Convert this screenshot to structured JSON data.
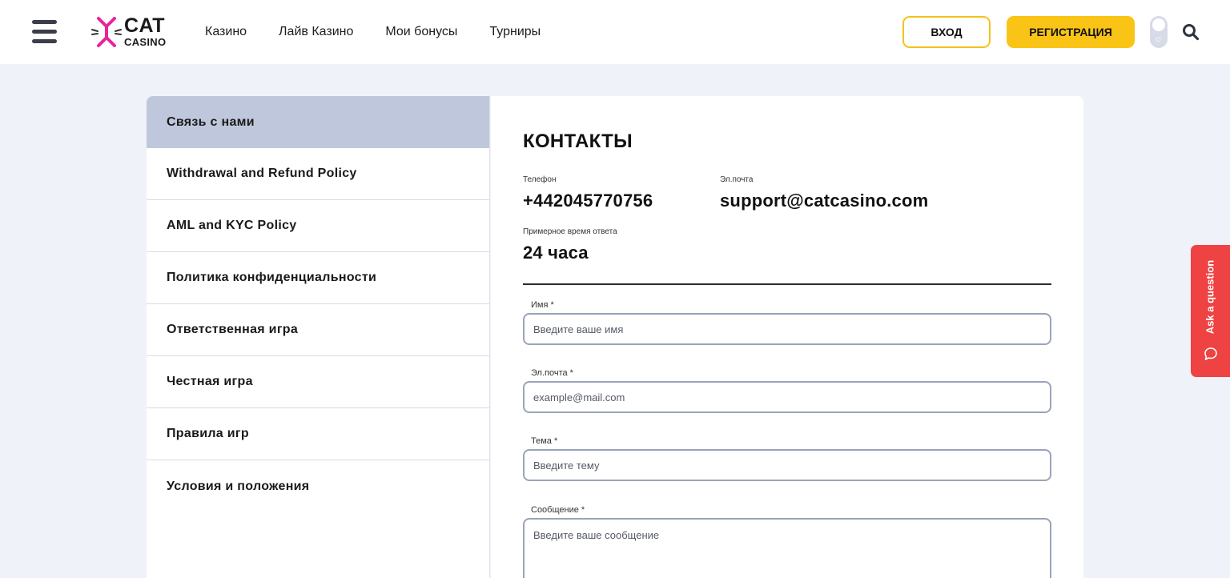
{
  "header": {
    "logo": {
      "line1": "CAT",
      "line2": "CASINO"
    },
    "nav": [
      "Казино",
      "Лайв Казино",
      "Мои бонусы",
      "Турниры"
    ],
    "login_label": "ВХОД",
    "register_label": "РЕГИСТРАЦИЯ",
    "brand_color": "#f9c415",
    "accent_color": "#e8249a"
  },
  "sidebar": {
    "items": [
      {
        "label": "Связь с нами",
        "active": true
      },
      {
        "label": "Withdrawal and Refund Policy"
      },
      {
        "label": "AML and KYC Policy"
      },
      {
        "label": "Политика конфиденциальности"
      },
      {
        "label": "Ответственная игра"
      },
      {
        "label": "Честная игра"
      },
      {
        "label": "Правила игр"
      },
      {
        "label": "Условия и положения"
      }
    ]
  },
  "contacts": {
    "title": "КОНТАКТЫ",
    "phone_label": "Телефон",
    "phone": "+442045770756",
    "email_label": "Эл.почта",
    "email": "support@catcasino.com",
    "response_label": "Примерное время ответа",
    "response_time": "24 часа"
  },
  "form": {
    "name_label": "Имя *",
    "name_placeholder": "Введите ваше имя",
    "email_label": "Эл.почта *",
    "email_placeholder": "example@mail.com",
    "subject_label": "Тема *",
    "subject_placeholder": "Введите тему",
    "message_label": "Сообщение *",
    "message_placeholder": "Введите ваше сообщение"
  },
  "ask_question": {
    "label": "Ask a question",
    "color": "#ef4242"
  }
}
